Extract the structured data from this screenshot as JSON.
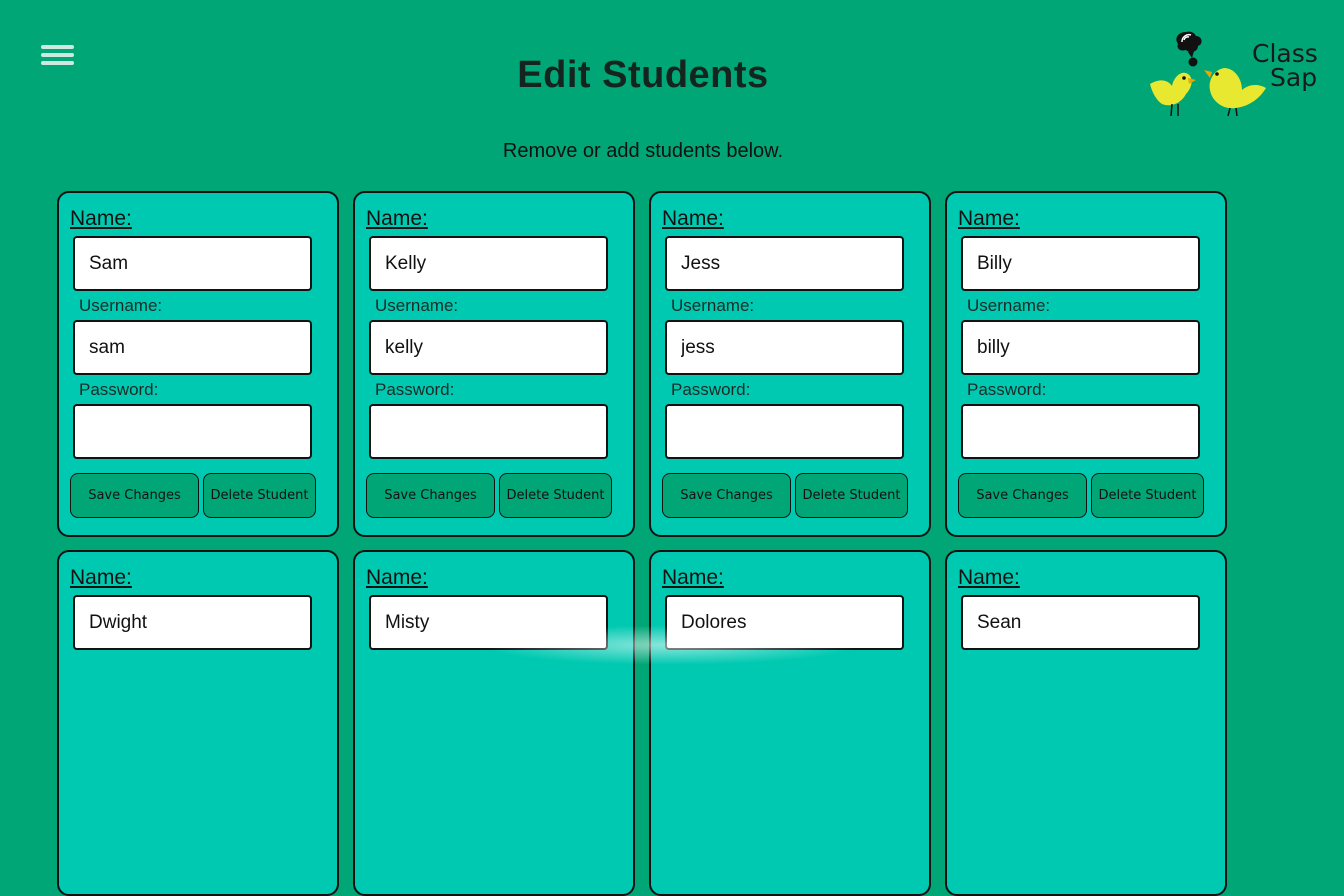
{
  "header": {
    "title": "Edit Students",
    "subtitle": "Remove or add students below."
  },
  "logo": {
    "line1": "Class",
    "line2": "Sap"
  },
  "labels": {
    "name": "Name:",
    "username": "Username:",
    "password": "Password:",
    "save": "Save Changes",
    "delete": "Delete Student"
  },
  "students": [
    {
      "name": "Sam",
      "username": "sam",
      "password": ""
    },
    {
      "name": "Kelly",
      "username": "kelly",
      "password": ""
    },
    {
      "name": "Jess",
      "username": "jess",
      "password": ""
    },
    {
      "name": "Billy",
      "username": "billy",
      "password": ""
    },
    {
      "name": "Dwight"
    },
    {
      "name": "Misty"
    },
    {
      "name": "Dolores"
    },
    {
      "name": "Sean"
    }
  ],
  "colors": {
    "background": "#00a676",
    "card": "#00c9b1",
    "button": "#00a676",
    "logo_birds": "#e8e831"
  }
}
